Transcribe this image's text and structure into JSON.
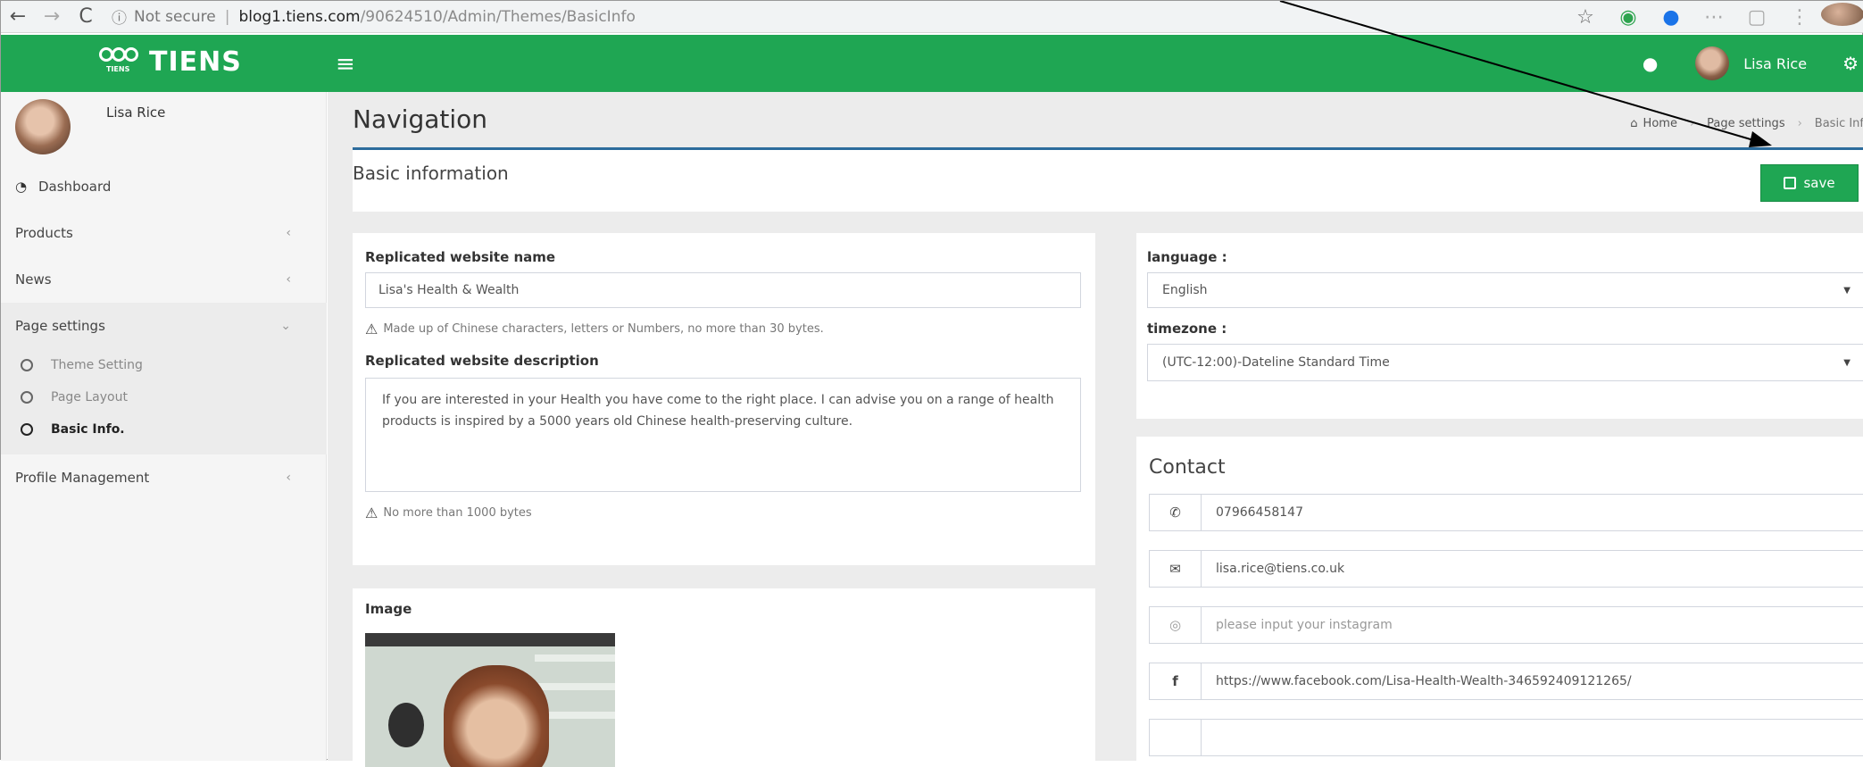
{
  "browser": {
    "back": "←",
    "forward": "→",
    "reload": "C",
    "security": "Not secure",
    "domain": "blog1.tiens.com",
    "path": "/90624510/Admin/Themes/BasicInfo"
  },
  "header": {
    "logo_text": "TIENS",
    "logo_sub": "TIENS",
    "user_name": "Lisa Rice"
  },
  "sidebar": {
    "user_name": "Lisa Rice",
    "items": [
      {
        "label": "Dashboard"
      },
      {
        "label": "Products"
      },
      {
        "label": "News"
      },
      {
        "label": "Page settings"
      },
      {
        "label": "Profile Management"
      }
    ],
    "page_settings_sub": [
      {
        "label": "Theme Setting"
      },
      {
        "label": "Page Layout"
      },
      {
        "label": "Basic Info."
      }
    ]
  },
  "page": {
    "title": "Navigation",
    "breadcrumb": [
      "Home",
      "Page settings",
      "Basic Inf"
    ],
    "section_title": "Basic information",
    "save_label": "save"
  },
  "form": {
    "site_name_label": "Replicated website name",
    "site_name_value": "Lisa's Health & Wealth",
    "site_name_hint": "Made up of Chinese characters, letters or Numbers, no more than 30 bytes.",
    "description_label": "Replicated website description",
    "description_value": "If you are interested in your Health you have come to the right place. I can advise you on a range of health products is inspired by a 5000 years old Chinese health-preserving culture.",
    "description_hint": "No more than 1000 bytes",
    "image_label": "Image",
    "language_label": "language :",
    "language_value": "English",
    "timezone_label": "timezone :",
    "timezone_value": "(UTC-12:00)-Dateline Standard Time"
  },
  "contact": {
    "title": "Contact",
    "phone": "07966458147",
    "email": "lisa.rice@tiens.co.uk",
    "instagram_placeholder": "please input your instagram",
    "facebook": "https://www.facebook.com/Lisa-Health-Wealth-346592409121265/"
  },
  "colors": {
    "brand_green": "#1fa653",
    "box_accent": "#2d6c9c"
  }
}
